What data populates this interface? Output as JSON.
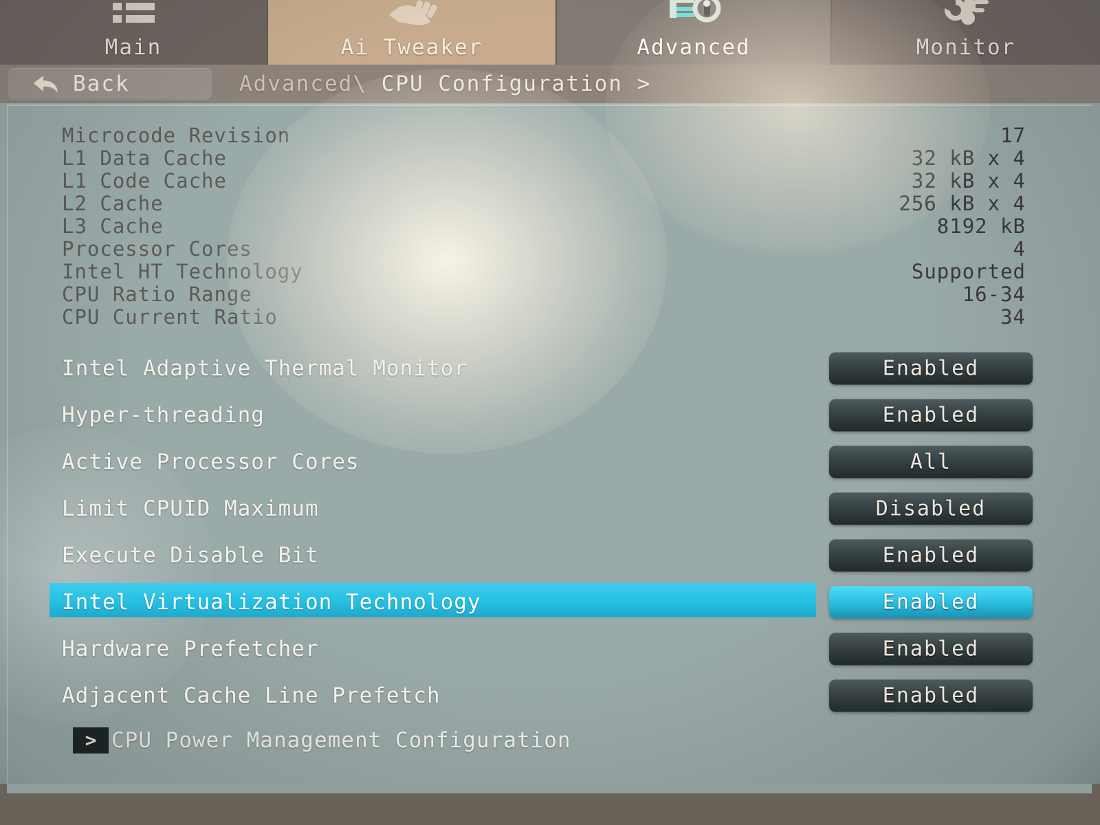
{
  "nav": {
    "tabs": [
      {
        "label": "Main",
        "icon": "list-icon",
        "active": false
      },
      {
        "label": "Ai Tweaker",
        "icon": "hand-tune-icon",
        "active": false
      },
      {
        "label": "Advanced",
        "icon": "cpu-gear-icon",
        "active": true
      },
      {
        "label": "Monitor",
        "icon": "fan-temp-icon",
        "active": false
      }
    ]
  },
  "breadcrumb": {
    "back_label": "Back",
    "back_icon": "back-arrow-icon",
    "parent": "Advanced\\",
    "current": "CPU Configuration",
    "chevron": ">"
  },
  "info": [
    {
      "label": "Microcode Revision",
      "value": "17"
    },
    {
      "label": "L1 Data Cache",
      "value": "32 kB x 4"
    },
    {
      "label": "L1 Code Cache",
      "value": "32 kB x 4"
    },
    {
      "label": "L2 Cache",
      "value": "256 kB x 4"
    },
    {
      "label": "L3 Cache",
      "value": "8192 kB"
    },
    {
      "label": "Processor Cores",
      "value": "4"
    },
    {
      "label": "Intel HT Technology",
      "value": "Supported"
    },
    {
      "label": "CPU Ratio Range",
      "value": "16-34"
    },
    {
      "label": "CPU Current Ratio",
      "value": "34"
    }
  ],
  "settings": [
    {
      "label": "Intel Adaptive Thermal Monitor",
      "value": "Enabled",
      "selected": false
    },
    {
      "label": "Hyper-threading",
      "value": "Enabled",
      "selected": false
    },
    {
      "label": "Active Processor Cores",
      "value": "All",
      "selected": false
    },
    {
      "label": "Limit CPUID Maximum",
      "value": "Disabled",
      "selected": false
    },
    {
      "label": "Execute Disable Bit",
      "value": "Enabled",
      "selected": false
    },
    {
      "label": "Intel Virtualization Technology",
      "value": "Enabled",
      "selected": true
    },
    {
      "label": "Hardware Prefetcher",
      "value": "Enabled",
      "selected": false
    },
    {
      "label": "Adjacent Cache Line Prefetch",
      "value": "Enabled",
      "selected": false
    }
  ],
  "submenu": {
    "arrow": ">",
    "label": "CPU Power Management Configuration"
  },
  "colors": {
    "panel_background": "#9aaaa8",
    "tabbar_background": "#6e6560",
    "active_tab_background": "#827a73",
    "aitweaker_tab_background": "#c7ab8c",
    "selection_cyan": "#26bfe2",
    "value_button_dark": "#394446",
    "info_label_text": "#5d5a58",
    "setting_label_text": "#f4f1ea"
  }
}
